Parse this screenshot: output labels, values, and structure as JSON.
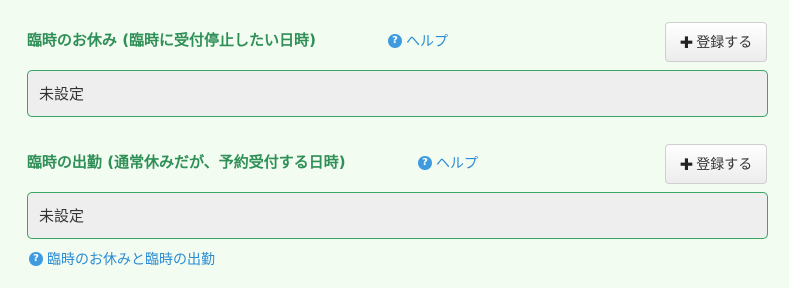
{
  "holiday": {
    "title": "臨時のお休み (臨時に受付停止したい日時)",
    "help_label": "ヘルプ",
    "register_label": "登録する",
    "value": "未設定"
  },
  "special_open": {
    "title": "臨時の出勤 (通常休みだが、予約受付する日時)",
    "help_label": "ヘルプ",
    "register_label": "登録する",
    "value": "未設定"
  },
  "footer_link": {
    "label": "臨時のお休みと臨時の出勤"
  },
  "icons": {
    "help": "question-circle-icon",
    "plus": "plus-icon"
  },
  "colors": {
    "background": "#f3fcf1",
    "title": "#2e8f57",
    "link": "#2b8cd2",
    "box_border": "#3aa565",
    "box_fill": "#eeeeee"
  }
}
